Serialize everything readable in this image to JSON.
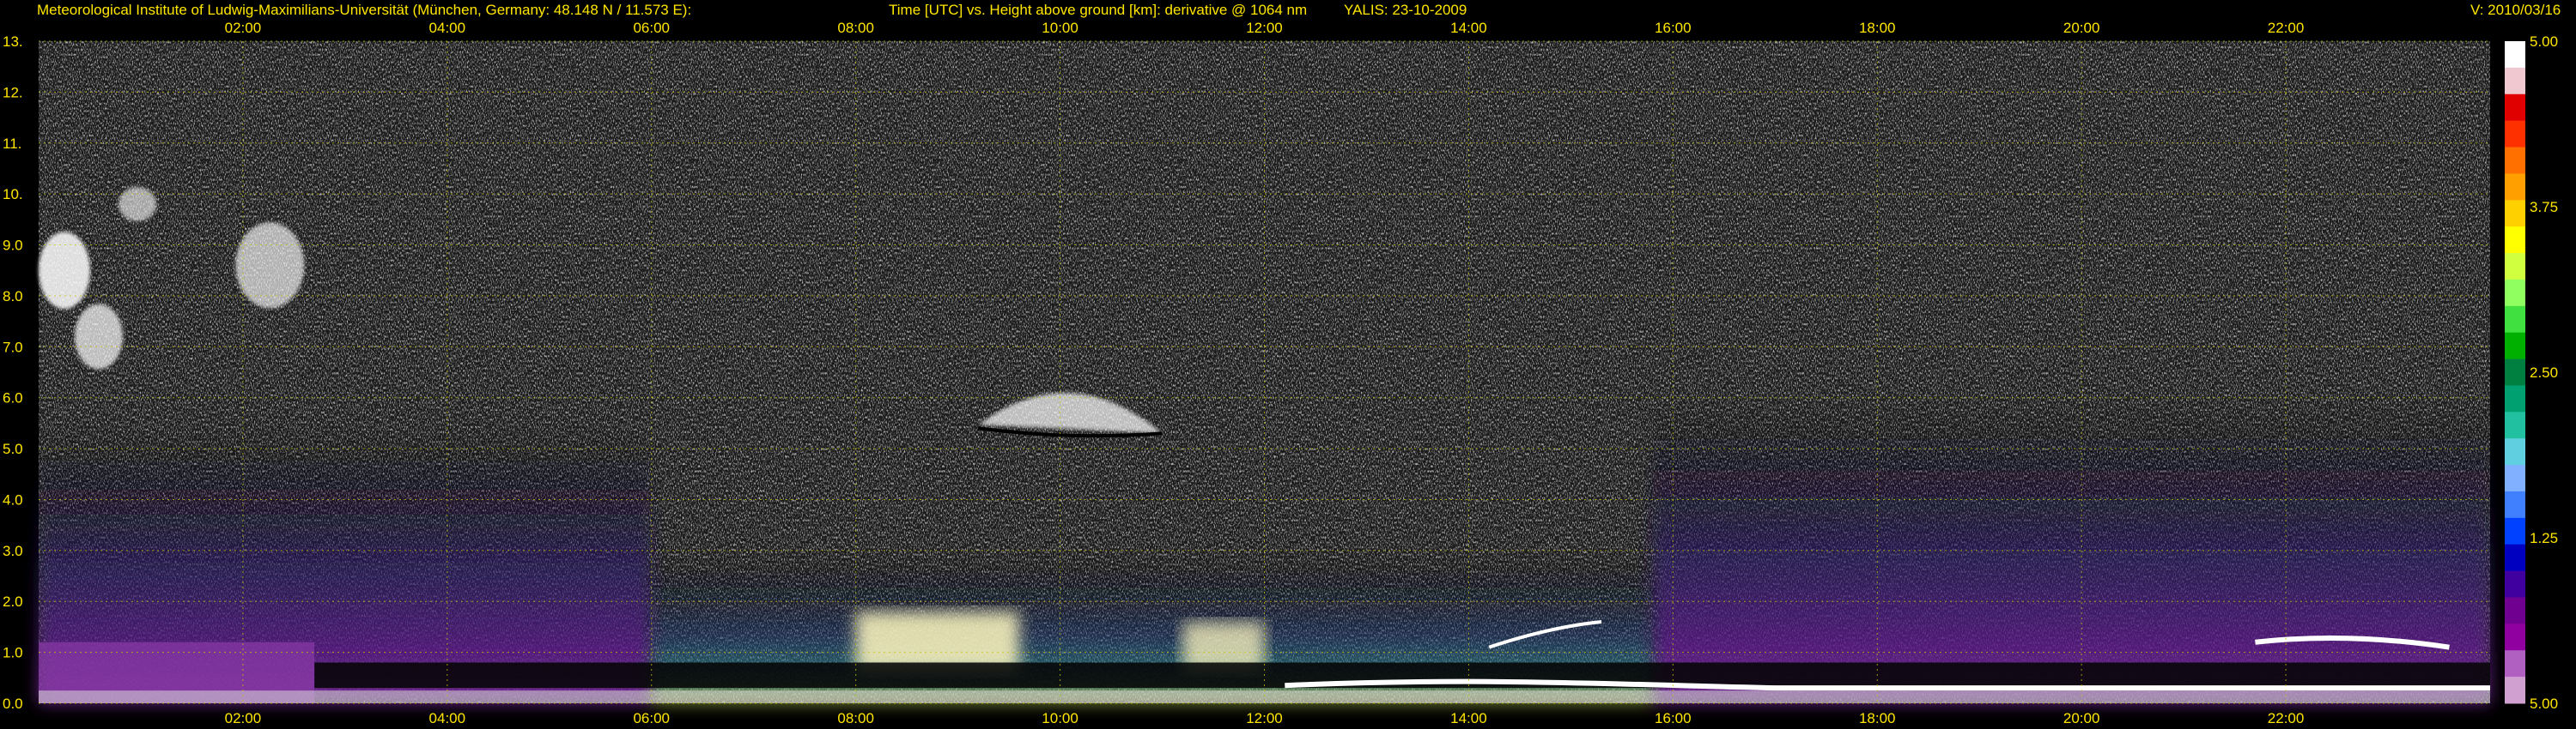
{
  "header": {
    "institute": "Meteorological Institute of Ludwig-Maximilians-Universität (München, Germany: 48.148 N / 11.573 E):",
    "title": "Time [UTC] vs. Height above ground [km]: derivative @ 1064 nm",
    "instrument": "YALIS: 23-10-2009",
    "version": "V: 2010/03/16"
  },
  "colors": {
    "text": "#ffe600",
    "grid": "#c8c800",
    "background": "#000000"
  },
  "chart_data": {
    "type": "heatmap",
    "xlabel": "Time [UTC]",
    "ylabel": "Height above ground [km]",
    "x_ticks": [
      "02:00",
      "04:00",
      "06:00",
      "08:00",
      "10:00",
      "12:00",
      "14:00",
      "16:00",
      "18:00",
      "20:00",
      "22:00"
    ],
    "x_tick_hours": [
      2,
      4,
      6,
      8,
      10,
      12,
      14,
      16,
      18,
      20,
      22
    ],
    "xlim_hours": [
      0,
      24
    ],
    "y_ticks": [
      "0.0",
      "1.0",
      "2.0",
      "3.0",
      "4.0",
      "5.0",
      "6.0",
      "7.0",
      "8.0",
      "9.0",
      "10.",
      "11.",
      "12.",
      "13."
    ],
    "y_tick_values": [
      0,
      1,
      2,
      3,
      4,
      5,
      6,
      7,
      8,
      9,
      10,
      11,
      12,
      13
    ],
    "ylim_km": [
      0,
      13
    ],
    "grid": true,
    "colorbar": {
      "ticks": [
        "5.00",
        "3.75",
        "2.50",
        "1.25",
        "5.00"
      ],
      "colors": [
        "#ffffff",
        "#f0c8d0",
        "#e00000",
        "#ff3000",
        "#ff7000",
        "#ffa000",
        "#ffd000",
        "#ffff00",
        "#d0ff40",
        "#90ff60",
        "#40e040",
        "#00b000",
        "#008040",
        "#00a070",
        "#20c0a0",
        "#60d0e0",
        "#80b0ff",
        "#4080ff",
        "#0040ff",
        "#0000c0",
        "#4000a0",
        "#700090",
        "#9000a0",
        "#b060c0",
        "#d0a0d0"
      ]
    },
    "features": [
      {
        "name": "cirrus clouds",
        "time_hours": [
          0.0,
          2.6
        ],
        "height_km": [
          6.0,
          10.0
        ]
      },
      {
        "name": "mid-level cloud",
        "time_hours": [
          9.2,
          11.0
        ],
        "height_km": [
          5.3,
          6.8
        ]
      },
      {
        "name": "boundary layer",
        "time_hours": [
          0.0,
          24.0
        ],
        "height_km": [
          0.0,
          1.0
        ]
      }
    ]
  }
}
